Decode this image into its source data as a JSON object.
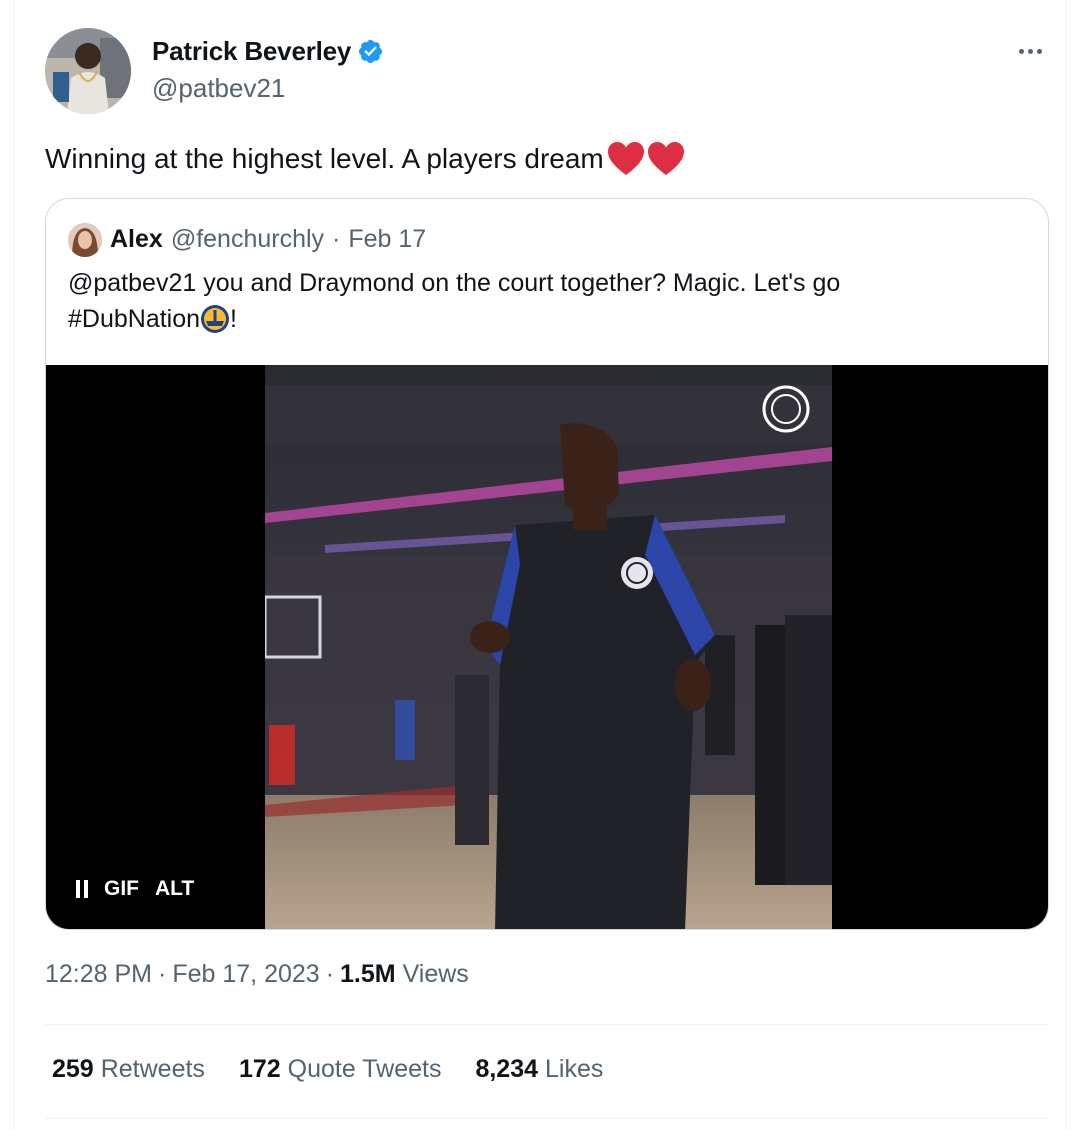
{
  "author": {
    "display_name": "Patrick Beverley",
    "handle": "@patbev21",
    "verified": true
  },
  "tweet": {
    "text": "Winning at the highest level. A players dream"
  },
  "quoted_tweet": {
    "display_name": "Alex",
    "handle": "@fenchurchly",
    "separator": "·",
    "date": "Feb 17",
    "text_line1": "@patbev21 you and Draymond on the court together? Magic. Let's go",
    "text_line2_pre": "#DubNation",
    "text_line2_post": "!",
    "media": {
      "type": "GIF",
      "gif_label": "GIF",
      "alt_label": "ALT"
    }
  },
  "meta": {
    "time": "12:28 PM",
    "sep1": "·",
    "date": "Feb 17, 2023",
    "sep2": "·",
    "views_count": "1.5M",
    "views_label": "Views"
  },
  "stats": {
    "retweets_count": "259",
    "retweets_label": "Retweets",
    "quotes_count": "172",
    "quotes_label": "Quote Tweets",
    "likes_count": "8,234",
    "likes_label": "Likes"
  },
  "colors": {
    "verified": "#1d9bf0",
    "heart": "#dd2e44",
    "secondary_text": "#536471"
  }
}
